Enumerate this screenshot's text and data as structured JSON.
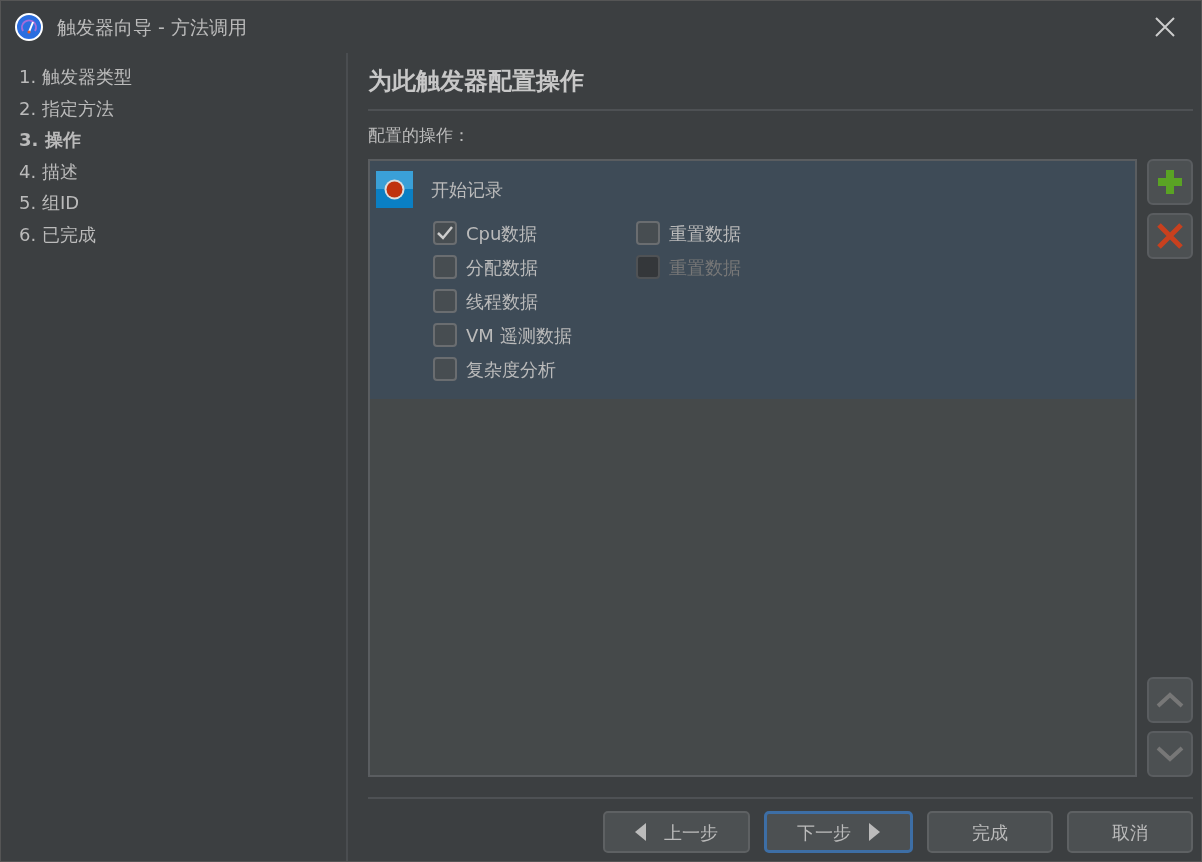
{
  "window": {
    "title": "触发器向导 - 方法调用"
  },
  "steps": [
    {
      "label": "1. 触发器类型",
      "selected": false
    },
    {
      "label": "2. 指定方法",
      "selected": false
    },
    {
      "label": "3. 操作",
      "selected": true
    },
    {
      "label": "4. 描述",
      "selected": false
    },
    {
      "label": "5. 组ID",
      "selected": false
    },
    {
      "label": "6. 已完成",
      "selected": false
    }
  ],
  "page": {
    "heading": "为此触发器配置操作",
    "list_label": "配置的操作："
  },
  "actions": [
    {
      "title": "开始记录",
      "selected": true,
      "option_columns": [
        [
          {
            "label": "Cpu数据",
            "checked": true,
            "disabled": false
          },
          {
            "label": "分配数据",
            "checked": false,
            "disabled": false
          },
          {
            "label": "线程数据",
            "checked": false,
            "disabled": false
          },
          {
            "label": "VM 遥测数据",
            "checked": false,
            "disabled": false
          },
          {
            "label": "复杂度分析",
            "checked": false,
            "disabled": false
          }
        ],
        [
          {
            "label": "重置数据",
            "checked": false,
            "disabled": false
          },
          {
            "label": "重置数据",
            "checked": false,
            "disabled": true
          }
        ]
      ]
    }
  ],
  "side_buttons": [
    {
      "kind": "add"
    },
    {
      "kind": "remove"
    },
    {
      "kind": "up"
    },
    {
      "kind": "down"
    }
  ],
  "footer_buttons": [
    {
      "label": "上一步",
      "kind": "back",
      "focused": false
    },
    {
      "label": "下一步",
      "kind": "next",
      "focused": true
    },
    {
      "label": "完成",
      "kind": "plain",
      "focused": false
    },
    {
      "label": "取消",
      "kind": "plain",
      "focused": false
    }
  ]
}
